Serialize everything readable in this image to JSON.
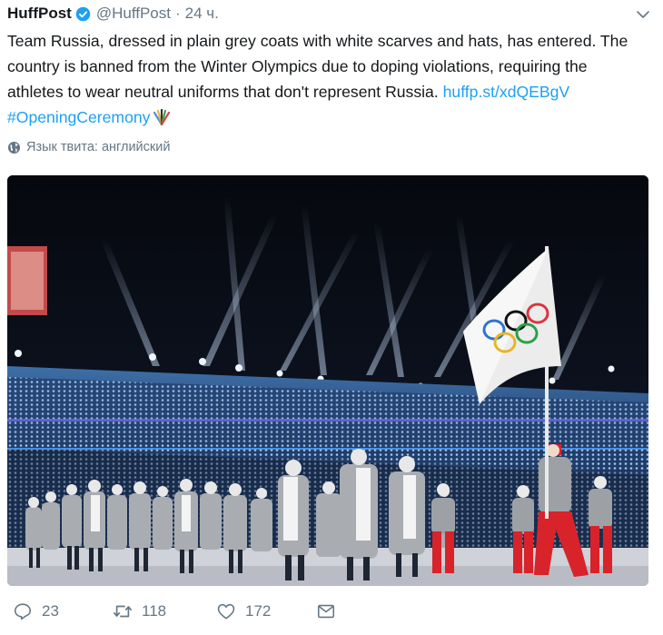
{
  "tweet": {
    "author_name": "HuffPost",
    "handle": "@HuffPost",
    "separator": "·",
    "time": "24 ч.",
    "text_main": "Team Russia, dressed in plain grey coats with white scarves and hats, has entered. The country is banned from the Winter Olympics due to doping violations, requiring the athletes to wear neutral uniforms that don't represent Russia.",
    "link": "huffp.st/xdQEBgV",
    "hashtag": "#OpeningCeremony",
    "language_note": "Язык твита: английский"
  },
  "icons": {
    "verified": "verified-badge-icon",
    "menu": "chevron-down-icon",
    "globe": "globe-icon",
    "emoji": "olympic-fan-emoji",
    "reply": "reply-icon",
    "retweet": "retweet-icon",
    "like": "heart-icon",
    "message": "envelope-icon"
  },
  "actions": {
    "reply_count": "23",
    "retweet_count": "118",
    "like_count": "172"
  },
  "colors": {
    "accent": "#1da1f2",
    "text": "#14171a",
    "muted": "#657786"
  }
}
